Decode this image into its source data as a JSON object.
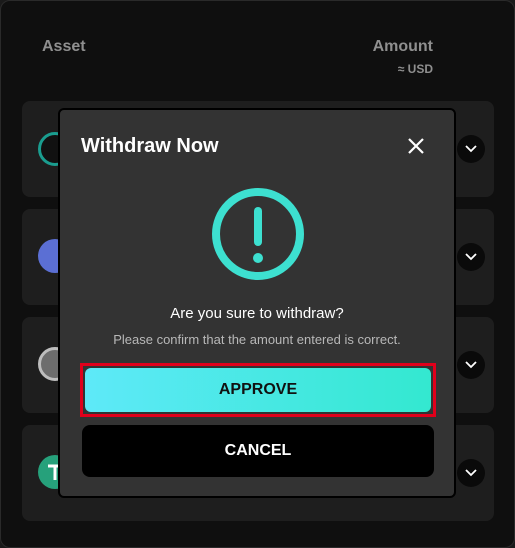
{
  "table": {
    "header_asset": "Asset",
    "header_amount": "Amount",
    "header_amount_unit": "≈ USD"
  },
  "rows": [
    {
      "icon": "teal-coin-icon",
      "color": "#1a9d8f"
    },
    {
      "icon": "ethereum-icon",
      "color": "#5b6fd4"
    },
    {
      "icon": "bitcoin-icon",
      "color": "#9a9a9a"
    },
    {
      "icon": "tether-icon",
      "color": "#26a17b"
    }
  ],
  "modal": {
    "title": "Withdraw Now",
    "question": "Are you sure to withdraw?",
    "subtext": "Please confirm that the amount entered is correct.",
    "approve_label": "APPROVE",
    "cancel_label": "CANCEL",
    "accent_color": "#3de0d0",
    "highlight_color": "#e0001b"
  }
}
